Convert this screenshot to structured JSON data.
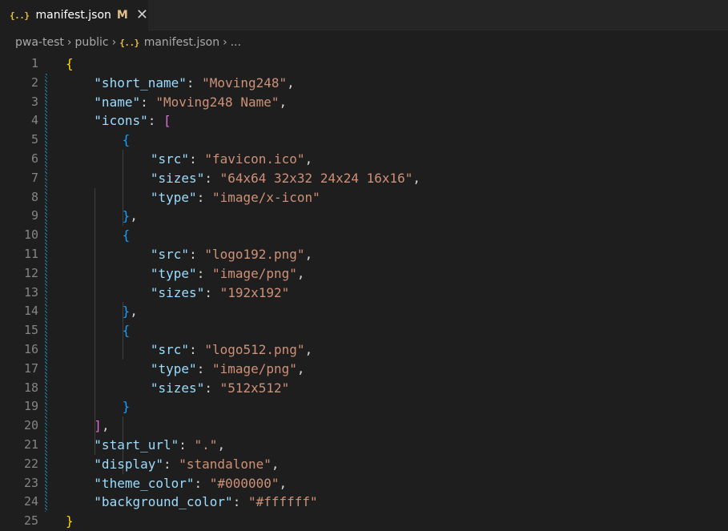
{
  "tab": {
    "icon": "json-icon",
    "icon_glyph": "{..}",
    "label": "manifest.json",
    "modified": "M",
    "close_glyph": "✕"
  },
  "breadcrumb": {
    "items": [
      "pwa-test",
      "public",
      "manifest.json",
      "..."
    ],
    "separator": "›"
  },
  "colors": {
    "key": "#9cdcfe",
    "string": "#ce9178",
    "bracket1": "#ffd700",
    "bracket2": "#da70d6",
    "bracket3": "#179fff",
    "line_number": "#858585"
  },
  "lines": [
    {
      "num": "1",
      "indent": 0,
      "tokens": [
        {
          "t": "{",
          "c": "b1"
        }
      ]
    },
    {
      "num": "2",
      "indent": 1,
      "tokens": [
        {
          "t": "\"short_name\"",
          "c": "key"
        },
        {
          "t": ": ",
          "c": "punc"
        },
        {
          "t": "\"Moving248\"",
          "c": "str"
        },
        {
          "t": ",",
          "c": "punc"
        }
      ]
    },
    {
      "num": "3",
      "indent": 1,
      "tokens": [
        {
          "t": "\"name\"",
          "c": "key"
        },
        {
          "t": ": ",
          "c": "punc"
        },
        {
          "t": "\"Moving248 Name\"",
          "c": "str"
        },
        {
          "t": ",",
          "c": "punc"
        }
      ]
    },
    {
      "num": "4",
      "indent": 1,
      "tokens": [
        {
          "t": "\"icons\"",
          "c": "key"
        },
        {
          "t": ": ",
          "c": "punc"
        },
        {
          "t": "[",
          "c": "b2"
        }
      ]
    },
    {
      "num": "5",
      "indent": 2,
      "tokens": [
        {
          "t": "{",
          "c": "b3"
        }
      ]
    },
    {
      "num": "6",
      "indent": 3,
      "tokens": [
        {
          "t": "\"src\"",
          "c": "key"
        },
        {
          "t": ": ",
          "c": "punc"
        },
        {
          "t": "\"favicon.ico\"",
          "c": "str"
        },
        {
          "t": ",",
          "c": "punc"
        }
      ]
    },
    {
      "num": "7",
      "indent": 3,
      "tokens": [
        {
          "t": "\"sizes\"",
          "c": "key"
        },
        {
          "t": ": ",
          "c": "punc"
        },
        {
          "t": "\"64x64 32x32 24x24 16x16\"",
          "c": "str"
        },
        {
          "t": ",",
          "c": "punc"
        }
      ]
    },
    {
      "num": "8",
      "indent": 3,
      "tokens": [
        {
          "t": "\"type\"",
          "c": "key"
        },
        {
          "t": ": ",
          "c": "punc"
        },
        {
          "t": "\"image/x-icon\"",
          "c": "str"
        }
      ]
    },
    {
      "num": "9",
      "indent": 2,
      "tokens": [
        {
          "t": "}",
          "c": "b3"
        },
        {
          "t": ",",
          "c": "punc"
        }
      ]
    },
    {
      "num": "10",
      "indent": 2,
      "tokens": [
        {
          "t": "{",
          "c": "b3"
        }
      ]
    },
    {
      "num": "11",
      "indent": 3,
      "tokens": [
        {
          "t": "\"src\"",
          "c": "key"
        },
        {
          "t": ": ",
          "c": "punc"
        },
        {
          "t": "\"logo192.png\"",
          "c": "str"
        },
        {
          "t": ",",
          "c": "punc"
        }
      ]
    },
    {
      "num": "12",
      "indent": 3,
      "tokens": [
        {
          "t": "\"type\"",
          "c": "key"
        },
        {
          "t": ": ",
          "c": "punc"
        },
        {
          "t": "\"image/png\"",
          "c": "str"
        },
        {
          "t": ",",
          "c": "punc"
        }
      ]
    },
    {
      "num": "13",
      "indent": 3,
      "tokens": [
        {
          "t": "\"sizes\"",
          "c": "key"
        },
        {
          "t": ": ",
          "c": "punc"
        },
        {
          "t": "\"192x192\"",
          "c": "str"
        }
      ]
    },
    {
      "num": "14",
      "indent": 2,
      "tokens": [
        {
          "t": "}",
          "c": "b3"
        },
        {
          "t": ",",
          "c": "punc"
        }
      ]
    },
    {
      "num": "15",
      "indent": 2,
      "tokens": [
        {
          "t": "{",
          "c": "b3"
        }
      ]
    },
    {
      "num": "16",
      "indent": 3,
      "tokens": [
        {
          "t": "\"src\"",
          "c": "key"
        },
        {
          "t": ": ",
          "c": "punc"
        },
        {
          "t": "\"logo512.png\"",
          "c": "str"
        },
        {
          "t": ",",
          "c": "punc"
        }
      ]
    },
    {
      "num": "17",
      "indent": 3,
      "tokens": [
        {
          "t": "\"type\"",
          "c": "key"
        },
        {
          "t": ": ",
          "c": "punc"
        },
        {
          "t": "\"image/png\"",
          "c": "str"
        },
        {
          "t": ",",
          "c": "punc"
        }
      ]
    },
    {
      "num": "18",
      "indent": 3,
      "tokens": [
        {
          "t": "\"sizes\"",
          "c": "key"
        },
        {
          "t": ": ",
          "c": "punc"
        },
        {
          "t": "\"512x512\"",
          "c": "str"
        }
      ]
    },
    {
      "num": "19",
      "indent": 2,
      "tokens": [
        {
          "t": "}",
          "c": "b3"
        }
      ]
    },
    {
      "num": "20",
      "indent": 1,
      "tokens": [
        {
          "t": "]",
          "c": "b2"
        },
        {
          "t": ",",
          "c": "punc"
        }
      ]
    },
    {
      "num": "21",
      "indent": 1,
      "tokens": [
        {
          "t": "\"start_url\"",
          "c": "key"
        },
        {
          "t": ": ",
          "c": "punc"
        },
        {
          "t": "\".\"",
          "c": "str"
        },
        {
          "t": ",",
          "c": "punc"
        }
      ]
    },
    {
      "num": "22",
      "indent": 1,
      "tokens": [
        {
          "t": "\"display\"",
          "c": "key"
        },
        {
          "t": ": ",
          "c": "punc"
        },
        {
          "t": "\"standalone\"",
          "c": "str"
        },
        {
          "t": ",",
          "c": "punc"
        }
      ]
    },
    {
      "num": "23",
      "indent": 1,
      "tokens": [
        {
          "t": "\"theme_color\"",
          "c": "key"
        },
        {
          "t": ": ",
          "c": "punc"
        },
        {
          "t": "\"#000000\"",
          "c": "str"
        },
        {
          "t": ",",
          "c": "punc"
        }
      ]
    },
    {
      "num": "24",
      "indent": 1,
      "tokens": [
        {
          "t": "\"background_color\"",
          "c": "key"
        },
        {
          "t": ": ",
          "c": "punc"
        },
        {
          "t": "\"#ffffff\"",
          "c": "str"
        }
      ]
    },
    {
      "num": "25",
      "indent": 0,
      "tokens": [
        {
          "t": "}",
          "c": "b1"
        }
      ]
    }
  ]
}
